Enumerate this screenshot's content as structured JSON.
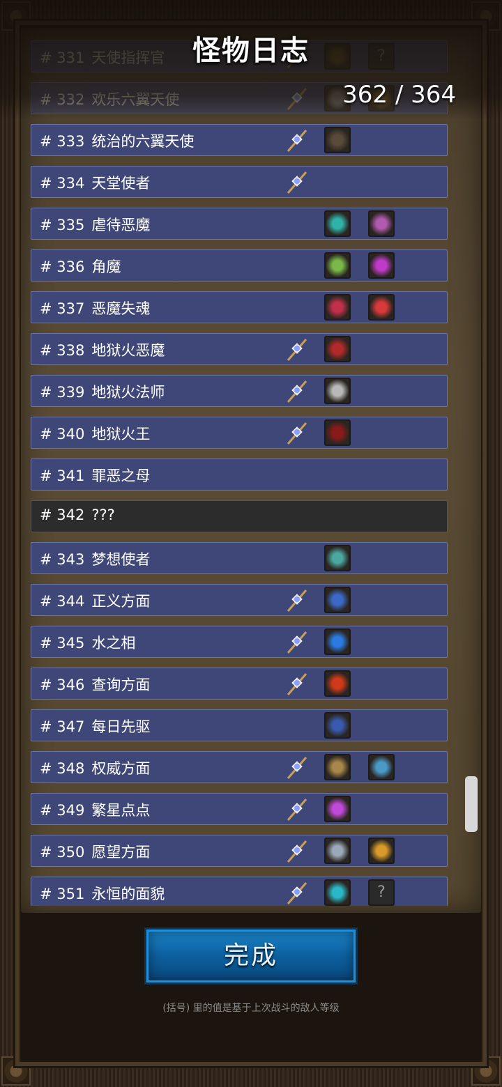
{
  "title": "怪物日志",
  "counter": "362 / 364",
  "done_label": "完成",
  "footnote": "(括号) 里的值是基于上次战斗的敌人等级",
  "unknown_slot_glyph": "?",
  "rows": [
    {
      "num": "# 331",
      "name": "天使指挥官",
      "state": "dimmed",
      "staff": true,
      "slot1": {
        "icon": "dark-tome-icon",
        "color": "#6a5a1e"
      },
      "slot2": {
        "icon": "unknown-item-icon"
      }
    },
    {
      "num": "# 332",
      "name": "欢乐六翼天使",
      "state": "dimmed",
      "staff": true,
      "slot1": {
        "icon": "grey-wings-icon",
        "color": "#8a8a8a"
      },
      "slot2": {
        "icon": "golden-wings-icon",
        "color": "#8a6a2a"
      }
    },
    {
      "num": "# 333",
      "name": "统治的六翼天使",
      "state": "normal",
      "staff": true,
      "slot1": {
        "icon": "dark-wings-icon",
        "color": "#5a4a3a"
      }
    },
    {
      "num": "# 334",
      "name": "天堂使者",
      "state": "normal",
      "staff": true
    },
    {
      "num": "# 335",
      "name": "虐待恶魔",
      "state": "normal",
      "staff": false,
      "slot1": {
        "icon": "amulet-teal-icon",
        "color": "#2fb2a8"
      },
      "slot2": {
        "icon": "amulet-purple-icon",
        "color": "#b05ab0"
      }
    },
    {
      "num": "# 336",
      "name": "角魔",
      "state": "normal",
      "staff": false,
      "slot1": {
        "icon": "amulet-green-icon",
        "color": "#7ab84a"
      },
      "slot2": {
        "icon": "amulet-magenta-icon",
        "color": "#c03ac8"
      }
    },
    {
      "num": "# 337",
      "name": "恶魔失魂",
      "state": "normal",
      "staff": false,
      "slot1": {
        "icon": "amulet-red-icon",
        "color": "#c0304a"
      },
      "slot2": {
        "icon": "amulet-crimson-icon",
        "color": "#d83a3a"
      }
    },
    {
      "num": "# 338",
      "name": "地狱火恶魔",
      "state": "normal",
      "staff": true,
      "slot1": {
        "icon": "red-wand-icon",
        "color": "#b02a2a"
      }
    },
    {
      "num": "# 339",
      "name": "地狱火法师",
      "state": "normal",
      "staff": true,
      "slot1": {
        "icon": "silver-wand-icon",
        "color": "#b8b8b8"
      }
    },
    {
      "num": "# 340",
      "name": "地狱火王",
      "state": "normal",
      "staff": true,
      "slot1": {
        "icon": "red-wings-icon",
        "color": "#8a1a1a"
      }
    },
    {
      "num": "# 341",
      "name": "罪恶之母",
      "state": "normal",
      "staff": false
    },
    {
      "num": "# 342",
      "name": "???",
      "state": "unknown",
      "staff": false
    },
    {
      "num": "# 343",
      "name": "梦想使者",
      "state": "normal",
      "staff": false,
      "slot1": {
        "icon": "teal-hat-icon",
        "color": "#4aa8a0"
      }
    },
    {
      "num": "# 344",
      "name": "正义方面",
      "state": "normal",
      "staff": true,
      "slot1": {
        "icon": "blue-armor-icon",
        "color": "#3a6ac8"
      }
    },
    {
      "num": "# 345",
      "name": "水之相",
      "state": "normal",
      "staff": true,
      "slot1": {
        "icon": "blue-potion-icon",
        "color": "#2a7ae0"
      }
    },
    {
      "num": "# 346",
      "name": "查询方面",
      "state": "normal",
      "staff": true,
      "slot1": {
        "icon": "red-tome-icon",
        "color": "#d03a1a"
      }
    },
    {
      "num": "# 347",
      "name": "每日先驱",
      "state": "normal",
      "staff": false,
      "slot1": {
        "icon": "blue-boots-icon",
        "color": "#3a5ab0"
      }
    },
    {
      "num": "# 348",
      "name": "权威方面",
      "state": "normal",
      "staff": true,
      "slot1": {
        "icon": "gold-gauntlets-icon",
        "color": "#a8884a"
      },
      "slot2": {
        "icon": "blue-axe-icon",
        "color": "#4a9ac8"
      }
    },
    {
      "num": "# 349",
      "name": "繁星点点",
      "state": "normal",
      "staff": true,
      "slot1": {
        "icon": "star-lantern-icon",
        "color": "#c04ad8"
      }
    },
    {
      "num": "# 350",
      "name": "愿望方面",
      "state": "normal",
      "staff": true,
      "slot1": {
        "icon": "crystal-orb-icon",
        "color": "#9aa8b8"
      },
      "slot2": {
        "icon": "gold-rings-icon",
        "color": "#d89a2a"
      }
    },
    {
      "num": "# 351",
      "name": "永恒的面貌",
      "state": "normal",
      "staff": true,
      "slot1": {
        "icon": "teal-gem-icon",
        "color": "#2ab8c8"
      },
      "slot2": {
        "icon": "unknown-item-icon"
      }
    }
  ]
}
